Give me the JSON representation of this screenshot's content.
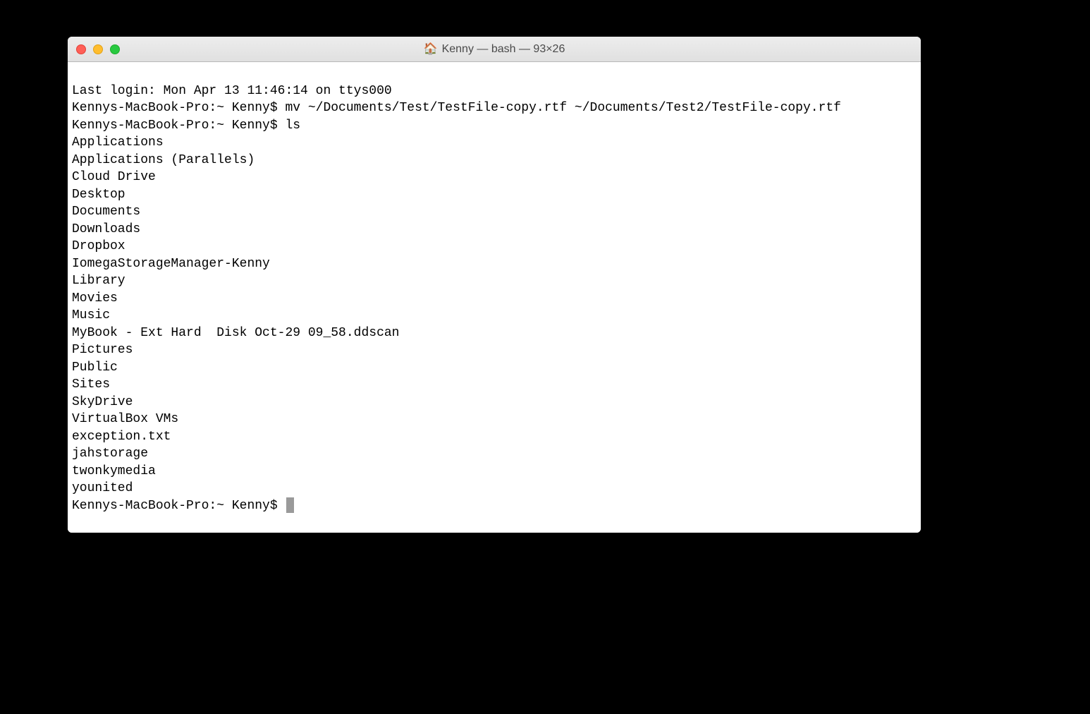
{
  "window": {
    "title": "Kenny — bash — 93×26"
  },
  "terminal": {
    "last_login": "Last login: Mon Apr 13 11:46:14 on ttys000",
    "prompt1": "Kennys-MacBook-Pro:~ Kenny$ mv ~/Documents/Test/TestFile-copy.rtf ~/Documents/Test2/TestFile-copy.rtf",
    "prompt2": "Kennys-MacBook-Pro:~ Kenny$ ls",
    "ls_output": [
      "Applications",
      "Applications (Parallels)",
      "Cloud Drive",
      "Desktop",
      "Documents",
      "Downloads",
      "Dropbox",
      "IomegaStorageManager-Kenny",
      "Library",
      "Movies",
      "Music",
      "MyBook - Ext Hard  Disk Oct-29 09_58.ddscan",
      "Pictures",
      "Public",
      "Sites",
      "SkyDrive",
      "VirtualBox VMs",
      "exception.txt",
      "jahstorage",
      "twonkymedia",
      "younited"
    ],
    "prompt3": "Kennys-MacBook-Pro:~ Kenny$ "
  }
}
